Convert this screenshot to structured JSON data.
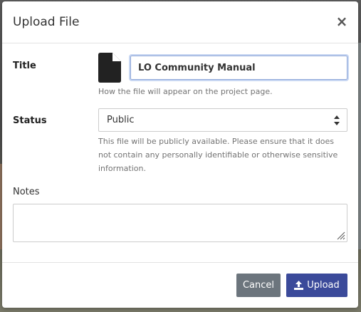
{
  "modal": {
    "title": "Upload File",
    "close_label": "×"
  },
  "form": {
    "title_label": "Title",
    "title_value": "LO Community Manual",
    "title_help": "How the file will appear on the project page.",
    "status_label": "Status",
    "status_value": "Public",
    "status_help": "This file will be publicly available. Please ensure that it does not contain any personally identifiable or otherwise sensitive information.",
    "notes_label": "Notes",
    "notes_value": ""
  },
  "footer": {
    "cancel_label": "Cancel",
    "upload_label": "Upload"
  },
  "icons": {
    "file": "file-icon",
    "select": "sort-arrows-icon",
    "upload": "upload-icon",
    "resize": "resize-grip-icon"
  },
  "colors": {
    "upload_button": "#3b4a9a",
    "cancel_button": "#6c757d",
    "input_focus": "#8fa8d8"
  }
}
